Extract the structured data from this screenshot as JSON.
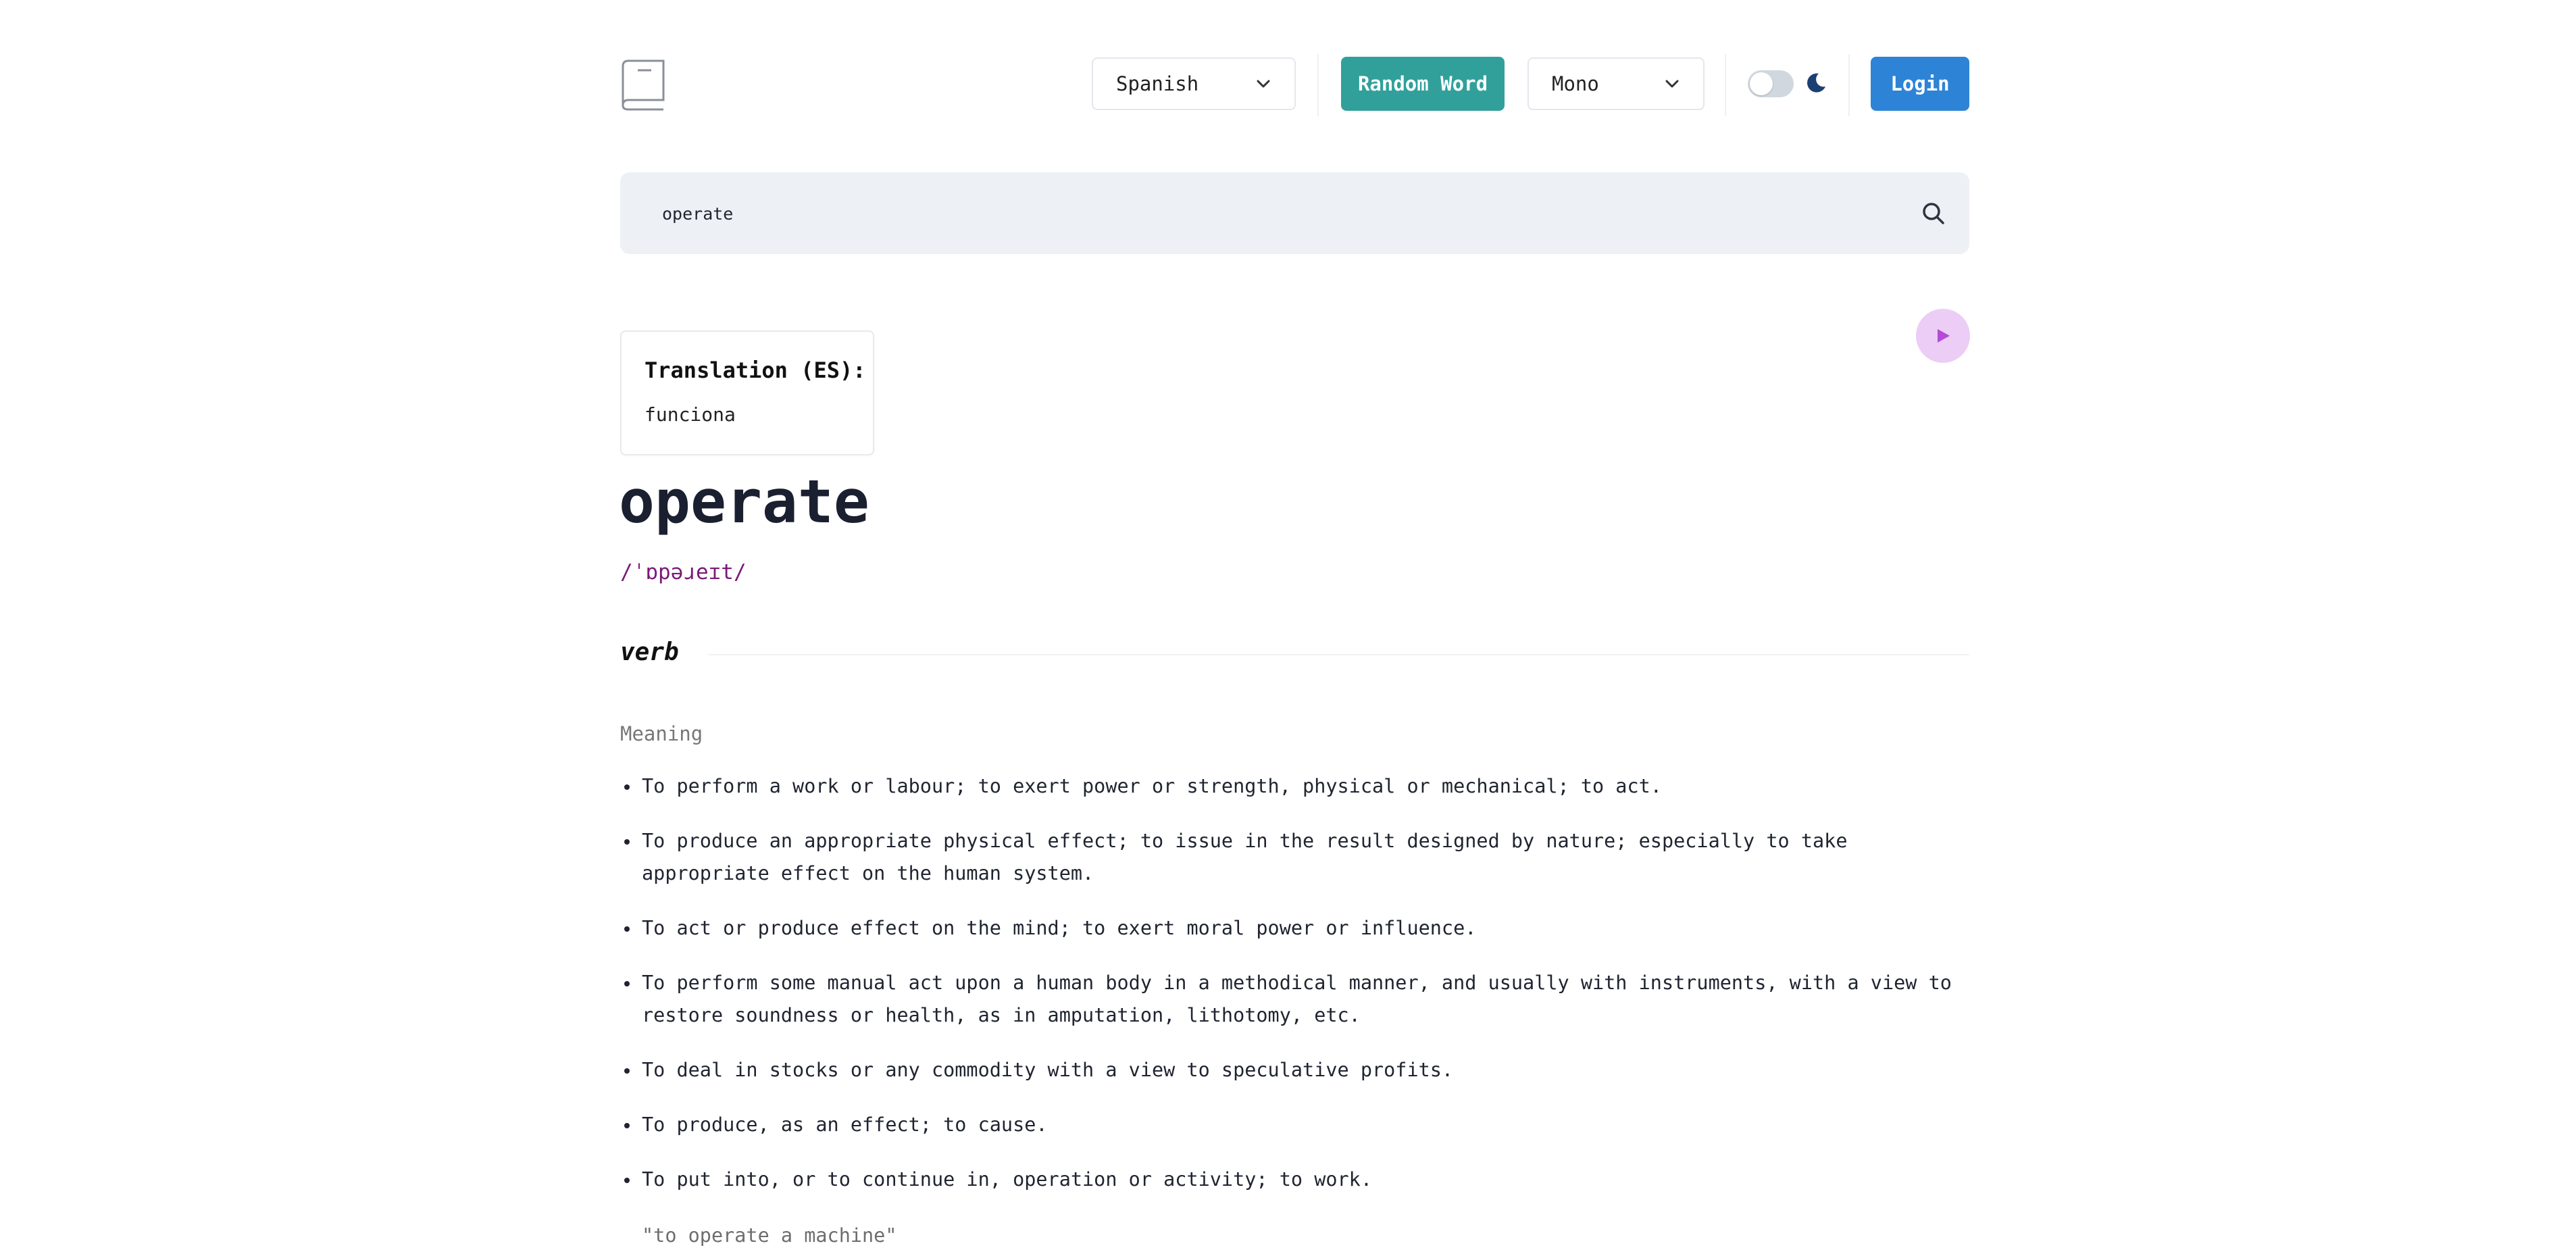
{
  "header": {
    "language_select": {
      "value": "Spanish",
      "icon": "chevron-down-icon"
    },
    "random_word_label": "Random Word",
    "font_select": {
      "value": "Mono",
      "icon": "chevron-down-icon"
    },
    "theme_toggle": {
      "state": "off",
      "icon": "moon-icon"
    },
    "login_label": "Login",
    "logo_icon": "book-icon"
  },
  "search": {
    "value": "operate",
    "icon": "search-icon"
  },
  "colors": {
    "random_button": "#31a09b",
    "login_button": "#2d84d6",
    "play_button_bg": "#ebcdf5",
    "play_icon": "#b44ad8",
    "phonetic": "#7a1a78",
    "moon": "#1c3f73"
  },
  "translation": {
    "title": "Translation (ES):",
    "value": "funciona"
  },
  "entry": {
    "word": "operate",
    "phonetic": "/ˈɒpəɹeɪt/",
    "play_icon": "play-icon",
    "part_of_speech": "verb",
    "meaning_label": "Meaning",
    "definitions": [
      "To perform a work or labour; to exert power or strength, physical or mechanical; to act.",
      "To produce an appropriate physical effect; to issue in the result designed by nature; especially to take appropriate effect on the human system.",
      "To act or produce effect on the mind; to exert moral power or influence.",
      "To perform some manual act upon a human body in a methodical manner, and usually with instruments, with a view to restore soundness or health, as in amputation, lithotomy, etc.",
      "To deal in stocks or any commodity with a view to speculative profits.",
      "To produce, as an effect; to cause.",
      "To put into, or to continue in, operation or activity; to work."
    ],
    "example": "\"to operate a machine\""
  }
}
